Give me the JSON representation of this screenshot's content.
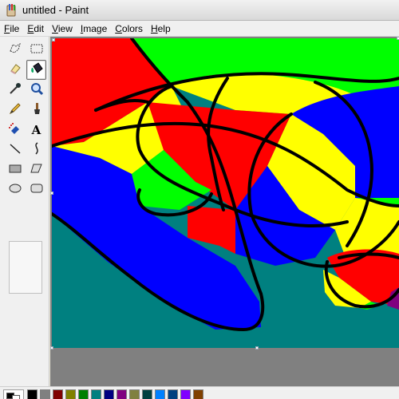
{
  "window": {
    "title": "untitled - Paint"
  },
  "menu": [
    {
      "label": "File",
      "key": "F",
      "rest": "ile"
    },
    {
      "label": "Edit",
      "key": "E",
      "rest": "dit"
    },
    {
      "label": "View",
      "key": "V",
      "rest": "iew"
    },
    {
      "label": "Image",
      "key": "I",
      "rest": "mage"
    },
    {
      "label": "Colors",
      "key": "C",
      "rest": "olors"
    },
    {
      "label": "Help",
      "key": "H",
      "rest": "elp"
    }
  ],
  "tools": [
    {
      "name": "free-form-select-icon"
    },
    {
      "name": "select-icon"
    },
    {
      "name": "eraser-icon"
    },
    {
      "name": "fill-bucket-icon",
      "selected": true
    },
    {
      "name": "color-picker-icon"
    },
    {
      "name": "magnifier-icon"
    },
    {
      "name": "pencil-icon"
    },
    {
      "name": "brush-icon"
    },
    {
      "name": "airbrush-icon"
    },
    {
      "name": "text-icon",
      "glyph": "A"
    },
    {
      "name": "line-icon"
    },
    {
      "name": "curve-icon"
    },
    {
      "name": "rectangle-icon"
    },
    {
      "name": "polygon-icon"
    },
    {
      "name": "ellipse-icon"
    },
    {
      "name": "rounded-rectangle-icon"
    }
  ],
  "canvas_colors": {
    "teal": "#008080",
    "red": "#ff0000",
    "green": "#00ff00",
    "yellow": "#ffff00",
    "blue": "#0000ff",
    "purple": "#800080",
    "outline": "#000000"
  },
  "current_colors": {
    "foreground": "#000000",
    "background": "#ffffff"
  },
  "palette": [
    "#000000",
    "#808080",
    "#800000",
    "#808000",
    "#008000",
    "#008080",
    "#000080",
    "#800080",
    "#808040",
    "#004040",
    "#0080ff",
    "#004080",
    "#8000ff",
    "#804000"
  ]
}
